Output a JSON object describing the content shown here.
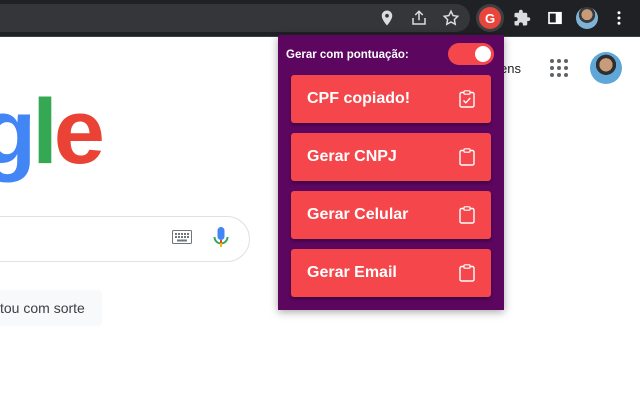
{
  "browser": {
    "toolbar_icons": [
      "location-icon",
      "share-icon",
      "star-icon",
      "gerador-extension-icon",
      "puzzle-icon",
      "sidebar-icon",
      "profile-avatar",
      "menu-icon"
    ],
    "extension_badge": "G"
  },
  "google": {
    "logo_letters": [
      "g",
      "l",
      "e"
    ],
    "images_link": "ens",
    "lucky_button": "tou com sorte"
  },
  "popup": {
    "header_label": "Gerar com pontuação:",
    "toggle_on": true,
    "buttons": [
      {
        "label": "CPF copiado!",
        "icon": "clipboard-check-icon"
      },
      {
        "label": "Gerar CNPJ",
        "icon": "clipboard-icon"
      },
      {
        "label": "Gerar Celular",
        "icon": "clipboard-icon"
      },
      {
        "label": "Gerar Email",
        "icon": "clipboard-icon"
      }
    ],
    "colors": {
      "background": "#5c0660",
      "button": "#f5474b"
    }
  }
}
